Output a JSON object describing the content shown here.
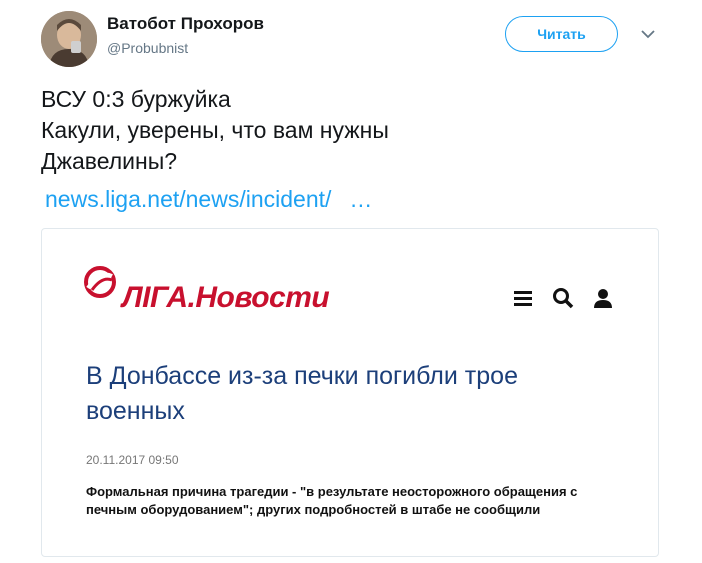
{
  "author": {
    "name": "Ватобот Прохоров",
    "handle": "@Probubnist",
    "avatar_icon": "user-photo"
  },
  "actions": {
    "follow_label": "Читать",
    "more_icon": "chevron-down-icon"
  },
  "tweet": {
    "lines": [
      "ВСУ 0:3 буржуйка",
      "Какули, уверены, что вам нужны",
      "Джавелины?"
    ],
    "link_text": "news.liga.net/news/incident/",
    "link_ellipsis": "…"
  },
  "card": {
    "logo_part1": "ЛІГА",
    "logo_part2": ".Новости",
    "headline": "В Донбассе из-за печки погибли трое военных",
    "date": "20.11.2017 09:50",
    "lead": "Формальная причина трагедии - \"в результате неосторожного обращения с печным оборудованием\"; других подробностей в штабе не сообщили",
    "icons": [
      "menu-icon",
      "search-icon",
      "user-icon"
    ]
  },
  "colors": {
    "link": "#1da1f2",
    "headline": "#1c3f7a",
    "brand_red": "#c8102e"
  }
}
